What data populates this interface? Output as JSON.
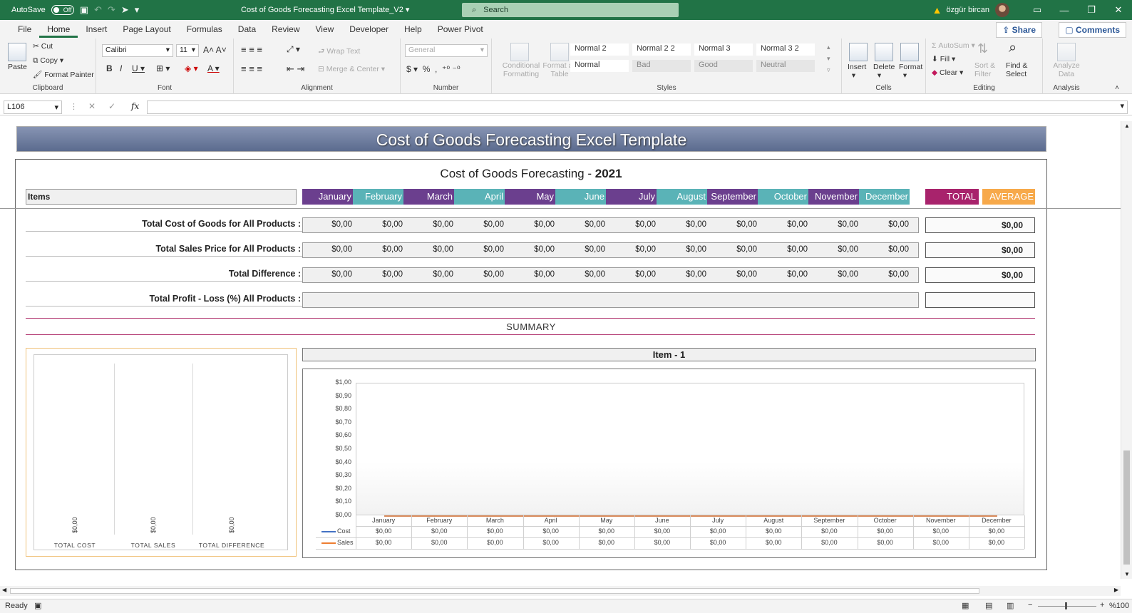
{
  "titlebar": {
    "autosave_label": "AutoSave",
    "autosave_state": "Off",
    "doc_title": "Cost of Goods Forecasting Excel Template_V2",
    "search_placeholder": "Search",
    "user_name": "özgür bircan"
  },
  "tabs": [
    "File",
    "Home",
    "Insert",
    "Page Layout",
    "Formulas",
    "Data",
    "Review",
    "View",
    "Developer",
    "Help",
    "Power Pivot"
  ],
  "tabs_active": "Home",
  "share_label": "Share",
  "comments_label": "Comments",
  "ribbon": {
    "clipboard": {
      "paste": "Paste",
      "cut": "Cut",
      "copy": "Copy",
      "format_painter": "Format Painter",
      "label": "Clipboard"
    },
    "font": {
      "name": "Calibri",
      "size": "11",
      "label": "Font"
    },
    "alignment": {
      "wrap": "Wrap Text",
      "merge": "Merge & Center",
      "label": "Alignment"
    },
    "number": {
      "format": "General",
      "label": "Number"
    },
    "styles": {
      "conditional": "Conditional Formatting",
      "format_table": "Format as Table",
      "cells": [
        "Normal 2",
        "Normal 2 2",
        "Normal 3",
        "Normal 3 2",
        "Normal",
        "Bad",
        "Good",
        "Neutral"
      ],
      "label": "Styles"
    },
    "cells": {
      "insert": "Insert",
      "delete": "Delete",
      "format": "Format",
      "label": "Cells"
    },
    "editing": {
      "autosum": "AutoSum",
      "fill": "Fill",
      "clear": "Clear",
      "sort": "Sort & Filter",
      "find": "Find & Select",
      "label": "Editing"
    },
    "analysis": {
      "analyze": "Analyze Data",
      "label": "Analysis"
    }
  },
  "formula_bar": {
    "name_box": "L106",
    "formula": ""
  },
  "sheet": {
    "banner": "Cost of Goods Forecasting Excel Template",
    "subtitle_text": "Cost of Goods Forecasting - ",
    "subtitle_year": "2021",
    "items_header": "Items",
    "months": [
      "January",
      "February",
      "March",
      "April",
      "May",
      "June",
      "July",
      "August",
      "September",
      "October",
      "November",
      "December"
    ],
    "total_header": "TOTAL",
    "average_header": "AVERAGE",
    "rows": [
      {
        "label": "Total Cost of Goods for All Products :",
        "values": [
          "$0,00",
          "$0,00",
          "$0,00",
          "$0,00",
          "$0,00",
          "$0,00",
          "$0,00",
          "$0,00",
          "$0,00",
          "$0,00",
          "$0,00",
          "$0,00"
        ],
        "total": "$0,00"
      },
      {
        "label": "Total Sales Price for All Products :",
        "values": [
          "$0,00",
          "$0,00",
          "$0,00",
          "$0,00",
          "$0,00",
          "$0,00",
          "$0,00",
          "$0,00",
          "$0,00",
          "$0,00",
          "$0,00",
          "$0,00"
        ],
        "total": "$0,00"
      },
      {
        "label": "Total Difference :",
        "values": [
          "$0,00",
          "$0,00",
          "$0,00",
          "$0,00",
          "$0,00",
          "$0,00",
          "$0,00",
          "$0,00",
          "$0,00",
          "$0,00",
          "$0,00",
          "$0,00"
        ],
        "total": "$0,00"
      },
      {
        "label": "Total Profit - Loss (%) All Products :",
        "values": [],
        "total": ""
      }
    ],
    "summary_label": "SUMMARY",
    "item_header": "Item - 1"
  },
  "chart_data": [
    {
      "type": "bar",
      "categories": [
        "TOTAL COST",
        "TOTAL SALES",
        "TOTAL DIFFERENCE"
      ],
      "values": [
        0,
        0,
        0
      ],
      "value_labels": [
        "$0,00",
        "$0,00",
        "$0,00"
      ]
    },
    {
      "type": "line",
      "categories": [
        "January",
        "February",
        "March",
        "April",
        "May",
        "June",
        "July",
        "August",
        "September",
        "October",
        "November",
        "December"
      ],
      "y_ticks": [
        "$1,00",
        "$0,90",
        "$0,80",
        "$0,70",
        "$0,60",
        "$0,50",
        "$0,40",
        "$0,30",
        "$0,20",
        "$0,10",
        "$0,00"
      ],
      "ylim": [
        0,
        1
      ],
      "series": [
        {
          "name": "Cost",
          "color": "#4472c4",
          "values": [
            0,
            0,
            0,
            0,
            0,
            0,
            0,
            0,
            0,
            0,
            0,
            0
          ],
          "labels": [
            "$0,00",
            "$0,00",
            "$0,00",
            "$0,00",
            "$0,00",
            "$0,00",
            "$0,00",
            "$0,00",
            "$0,00",
            "$0,00",
            "$0,00",
            "$0,00"
          ]
        },
        {
          "name": "Sales",
          "color": "#ed7d31",
          "values": [
            0,
            0,
            0,
            0,
            0,
            0,
            0,
            0,
            0,
            0,
            0,
            0
          ],
          "labels": [
            "$0,00",
            "$0,00",
            "$0,00",
            "$0,00",
            "$0,00",
            "$0,00",
            "$0,00",
            "$0,00",
            "$0,00",
            "$0,00",
            "$0,00",
            "$0,00"
          ]
        }
      ]
    }
  ],
  "status": {
    "ready": "Ready",
    "zoom": "%100"
  },
  "colors": {
    "excel_green": "#217346",
    "month_purple": "#6b3f8e",
    "month_teal": "#5ab3b7",
    "total": "#a8236c",
    "average": "#f7a94a"
  }
}
